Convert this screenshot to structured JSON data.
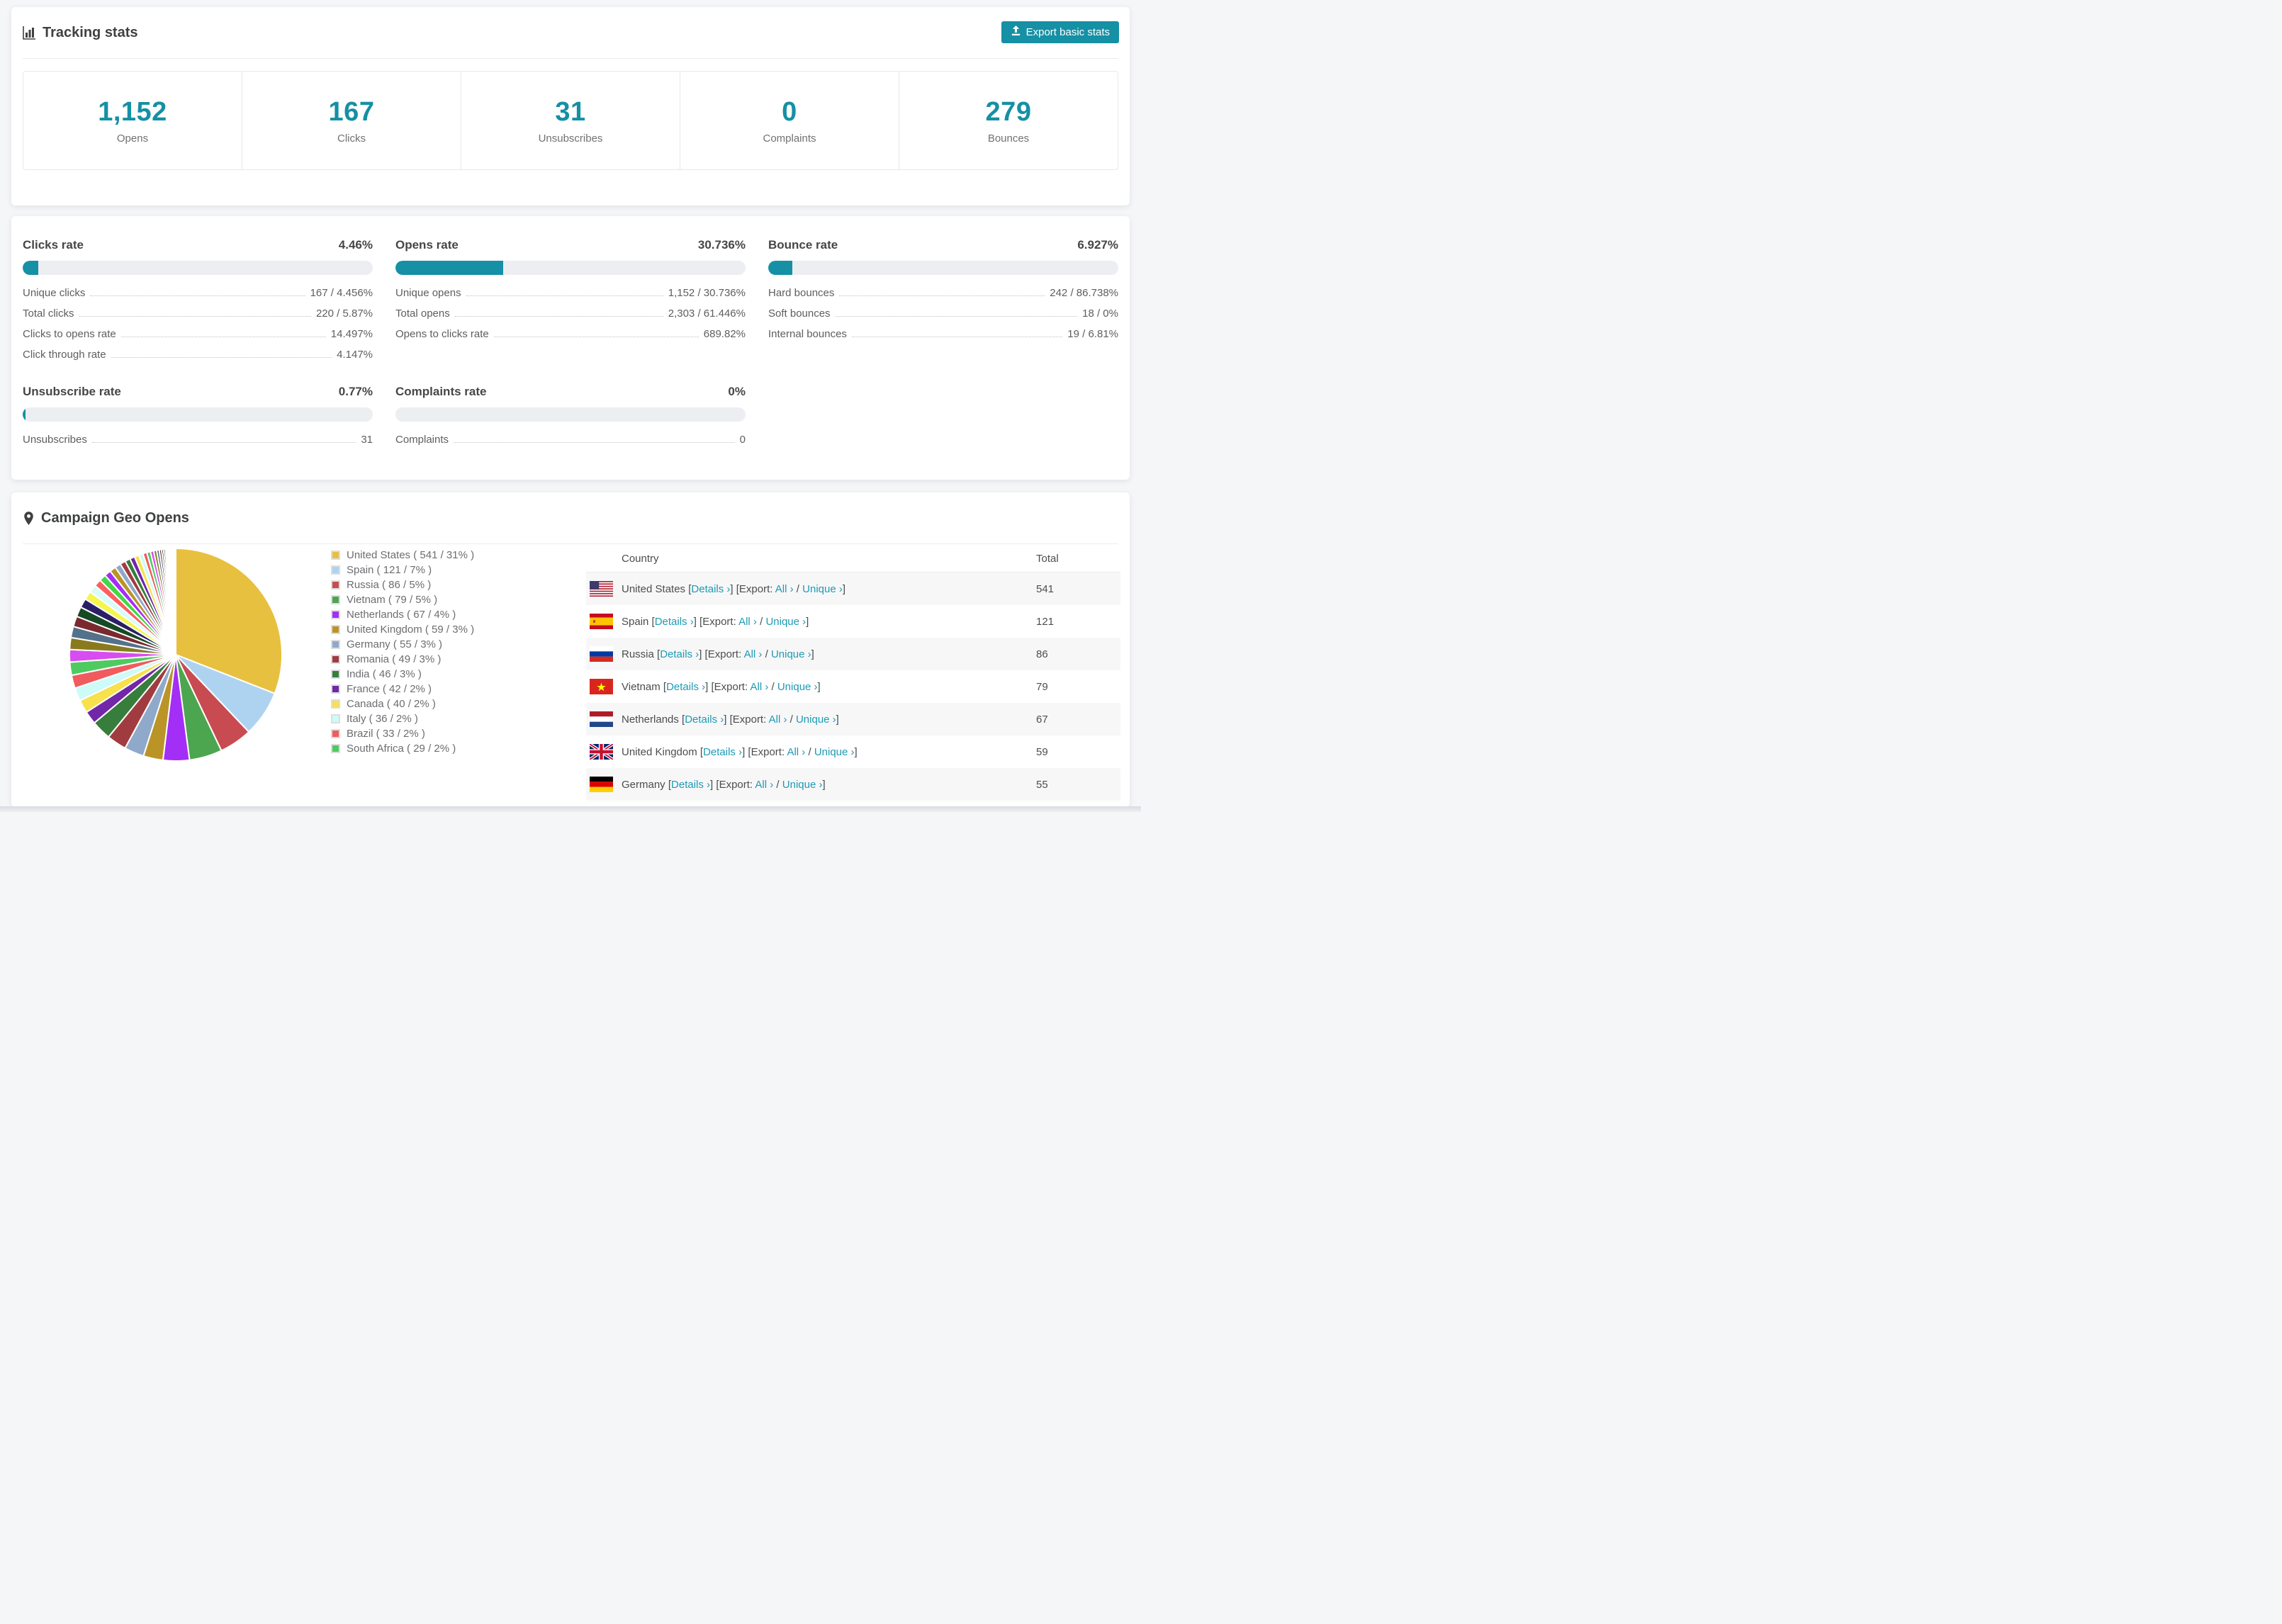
{
  "accent": "#1590a4",
  "page_bg": "#f5f6f8",
  "tracking": {
    "title": "Tracking stats",
    "export_label": "Export basic stats",
    "stats": [
      {
        "value": "1,152",
        "label": "Opens"
      },
      {
        "value": "167",
        "label": "Clicks"
      },
      {
        "value": "31",
        "label": "Unsubscribes"
      },
      {
        "value": "0",
        "label": "Complaints"
      },
      {
        "value": "279",
        "label": "Bounces"
      }
    ]
  },
  "rates": {
    "clicks": {
      "title": "Clicks rate",
      "value": "4.46%",
      "pct": 4.46,
      "rows": [
        [
          "Unique clicks",
          "167 / 4.456%"
        ],
        [
          "Total clicks",
          "220 / 5.87%"
        ],
        [
          "Clicks to opens rate",
          "14.497%"
        ],
        [
          "Click through rate",
          "4.147%"
        ]
      ]
    },
    "opens": {
      "title": "Opens rate",
      "value": "30.736%",
      "pct": 30.736,
      "rows": [
        [
          "Unique opens",
          "1,152 / 30.736%"
        ],
        [
          "Total opens",
          "2,303 / 61.446%"
        ],
        [
          "Opens to clicks rate",
          "689.82%"
        ]
      ]
    },
    "bounce": {
      "title": "Bounce rate",
      "value": "6.927%",
      "pct": 6.927,
      "rows": [
        [
          "Hard bounces",
          "242 / 86.738%"
        ],
        [
          "Soft bounces",
          "18 / 0%"
        ],
        [
          "Internal bounces",
          "19 / 6.81%"
        ]
      ]
    },
    "unsubscribe": {
      "title": "Unsubscribe rate",
      "value": "0.77%",
      "pct": 0.77,
      "rows": [
        [
          "Unsubscribes",
          "31"
        ]
      ]
    },
    "complaints": {
      "title": "Complaints rate",
      "value": "0%",
      "pct": 0,
      "rows": [
        [
          "Complaints",
          "0"
        ]
      ]
    }
  },
  "geo": {
    "title": "Campaign Geo Opens",
    "table": {
      "col_country": "Country",
      "col_total": "Total",
      "link_details": "Details",
      "link_export": "Export:",
      "link_all": "All",
      "link_unique": "Unique",
      "chevron": "›",
      "bracket_open": "[",
      "bracket_close": "]",
      "slash": "/",
      "rows": [
        {
          "country": "United States",
          "total": "541",
          "flag": "us"
        },
        {
          "country": "Spain",
          "total": "121",
          "flag": "es"
        },
        {
          "country": "Russia",
          "total": "86",
          "flag": "ru"
        },
        {
          "country": "Vietnam",
          "total": "79",
          "flag": "vn"
        },
        {
          "country": "Netherlands",
          "total": "67",
          "flag": "nl"
        },
        {
          "country": "United Kingdom",
          "total": "59",
          "flag": "gb"
        },
        {
          "country": "Germany",
          "total": "55",
          "flag": "de"
        }
      ]
    },
    "chart_data": {
      "type": "pie",
      "title": "Campaign Geo Opens",
      "unit": "opens",
      "legend_position": "right",
      "countries": [
        {
          "name": "United States",
          "count": 541,
          "pct": 31,
          "color": "#e8c03f"
        },
        {
          "name": "Spain",
          "count": 121,
          "pct": 7,
          "color": "#aed3f0"
        },
        {
          "name": "Russia",
          "count": 86,
          "pct": 5,
          "color": "#c84b52"
        },
        {
          "name": "Vietnam",
          "count": 79,
          "pct": 5,
          "color": "#4ca64f"
        },
        {
          "name": "Netherlands",
          "count": 67,
          "pct": 4,
          "color": "#a32ef5"
        },
        {
          "name": "United Kingdom",
          "count": 59,
          "pct": 3,
          "color": "#bb9427"
        },
        {
          "name": "Germany",
          "count": 55,
          "pct": 3,
          "color": "#8fa9cb"
        },
        {
          "name": "Romania",
          "count": 49,
          "pct": 3,
          "color": "#a03c40"
        },
        {
          "name": "India",
          "count": 46,
          "pct": 3,
          "color": "#377d3c"
        },
        {
          "name": "France",
          "count": 42,
          "pct": 2,
          "color": "#7227a8"
        },
        {
          "name": "Canada",
          "count": 40,
          "pct": 2,
          "color": "#f7e14c"
        },
        {
          "name": "Italy",
          "count": 36,
          "pct": 2,
          "color": "#ccfbf8"
        },
        {
          "name": "Brazil",
          "count": 33,
          "pct": 2,
          "color": "#f15b5e"
        },
        {
          "name": "South Africa",
          "count": 29,
          "pct": 2,
          "color": "#4fca61"
        }
      ],
      "other_slices_pct": [
        1.9,
        1.8,
        1.7,
        1.6,
        1.5,
        1.4,
        1.3,
        1.2,
        1.1,
        1.05,
        1.0,
        0.95,
        0.9,
        0.85,
        0.8,
        0.75,
        0.7,
        0.65,
        0.6,
        0.55,
        0.5,
        0.45,
        0.4,
        0.35,
        0.3,
        0.27,
        0.24,
        0.21,
        0.18,
        0.16,
        0.14,
        0.12,
        0.1,
        0.09,
        0.08,
        0.07,
        0.06,
        0.05,
        0.04,
        0.04
      ],
      "other_palette": [
        "#d74df0",
        "#8a7a1e",
        "#53718a",
        "#7a2a2e",
        "#164a24",
        "#2a1f66",
        "#f5f54e",
        "#d9fbfa",
        "#fa5f5f",
        "#46d546",
        "#a32ef5",
        "#bb9427",
        "#8fa9cb",
        "#a03c40",
        "#377d3c",
        "#7227a8",
        "#f7e14c",
        "#ccfbf8",
        "#f15b5e",
        "#4fca61"
      ]
    }
  }
}
